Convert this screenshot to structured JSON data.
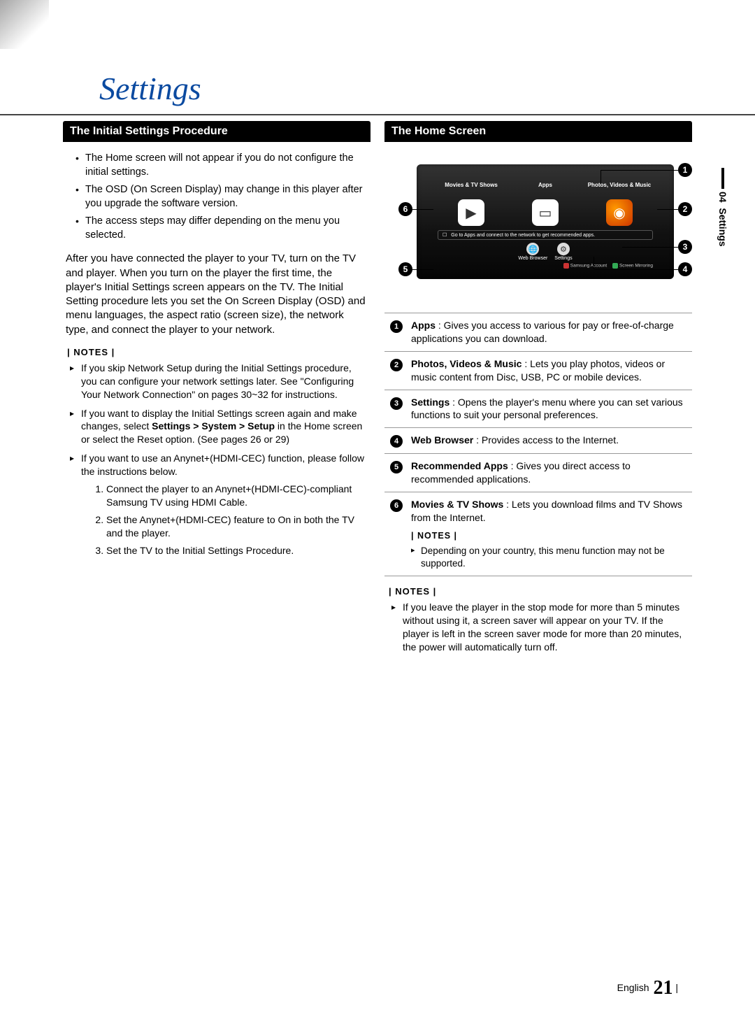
{
  "chapter": {
    "title": "Settings"
  },
  "side_tab": {
    "chapter_num": "04",
    "label": "Settings"
  },
  "left": {
    "heading": "The Initial Settings Procedure",
    "bullets": [
      "The Home screen will not appear if you do not configure the initial settings.",
      "The OSD (On Screen Display) may change in this player after you upgrade the software version.",
      "The access steps may differ depending on the menu you selected."
    ],
    "paragraph": "After you have connected the player to your TV, turn on the TV and player. When you turn on the player the first time, the player's Initial Settings screen appears on the TV. The Initial Setting procedure lets you set the On Screen Display (OSD) and menu languages, the aspect ratio (screen size), the network type, and connect the player to your network.",
    "notes_label": "| NOTES |",
    "notes": [
      {
        "text_before": "If you skip Network Setup during the Initial Settings procedure, you can configure your network settings later. See \"Configuring Your Network Connection\" on pages 30~32 for instructions."
      },
      {
        "text_before": "If you want to display the Initial Settings screen again and make changes, select ",
        "bold": "Settings > System > Setup",
        "text_after": " in the Home screen or select the Reset option. (See pages 26 or 29)"
      },
      {
        "text_before": "If you want to use an Anynet+(HDMI-CEC) function, please follow the instructions below.",
        "sub": [
          "Connect the player to an Anynet+(HDMI-CEC)-compliant Samsung TV using HDMI Cable.",
          "Set the Anynet+(HDMI-CEC) feature to On in both the TV and the player.",
          "Set the TV to the Initial Settings Procedure."
        ]
      }
    ]
  },
  "right": {
    "heading": "The Home Screen",
    "hs": {
      "tiles": {
        "movies": "Movies & TV Shows",
        "apps": "Apps",
        "photos": "Photos, Videos & Music"
      },
      "rec_bar": "Go to Apps and connect to the network to get recommended apps.",
      "small": {
        "web": "Web Browser",
        "settings": "Settings"
      },
      "footer": {
        "a_label": "Samsung Account",
        "b_label": "Screen Mirroring",
        "a_key": "A",
        "b_key": "B"
      }
    },
    "callouts": [
      {
        "n": "1",
        "bold": "Apps",
        "text": " : Gives you access to various for pay or free-of-charge applications you can download."
      },
      {
        "n": "2",
        "bold": "Photos, Videos & Music",
        "text": " : Lets you play photos, videos or music content from Disc, USB, PC or mobile devices."
      },
      {
        "n": "3",
        "bold": "Settings",
        "text": " : Opens the player's menu where you can set various functions to suit your personal preferences."
      },
      {
        "n": "4",
        "bold": "Web Browser",
        "text": " : Provides access to the Internet."
      },
      {
        "n": "5",
        "bold": "Recommended Apps",
        "text": " : Gives you direct access to recommended applications."
      },
      {
        "n": "6",
        "bold": "Movies & TV Shows",
        "text": " : Lets you download films and TV Shows from the Internet.",
        "notes_label": "| NOTES |",
        "note": "Depending on your country, this menu function may not be supported."
      }
    ],
    "bottom_notes_label": "| NOTES |",
    "bottom_note": "If you leave the player in the stop mode for more than 5 minutes without using it, a screen saver will appear on your TV. If the player is left in the screen saver mode for more than 20 minutes, the power will automatically turn off."
  },
  "footer": {
    "lang": "English",
    "page": "21"
  }
}
